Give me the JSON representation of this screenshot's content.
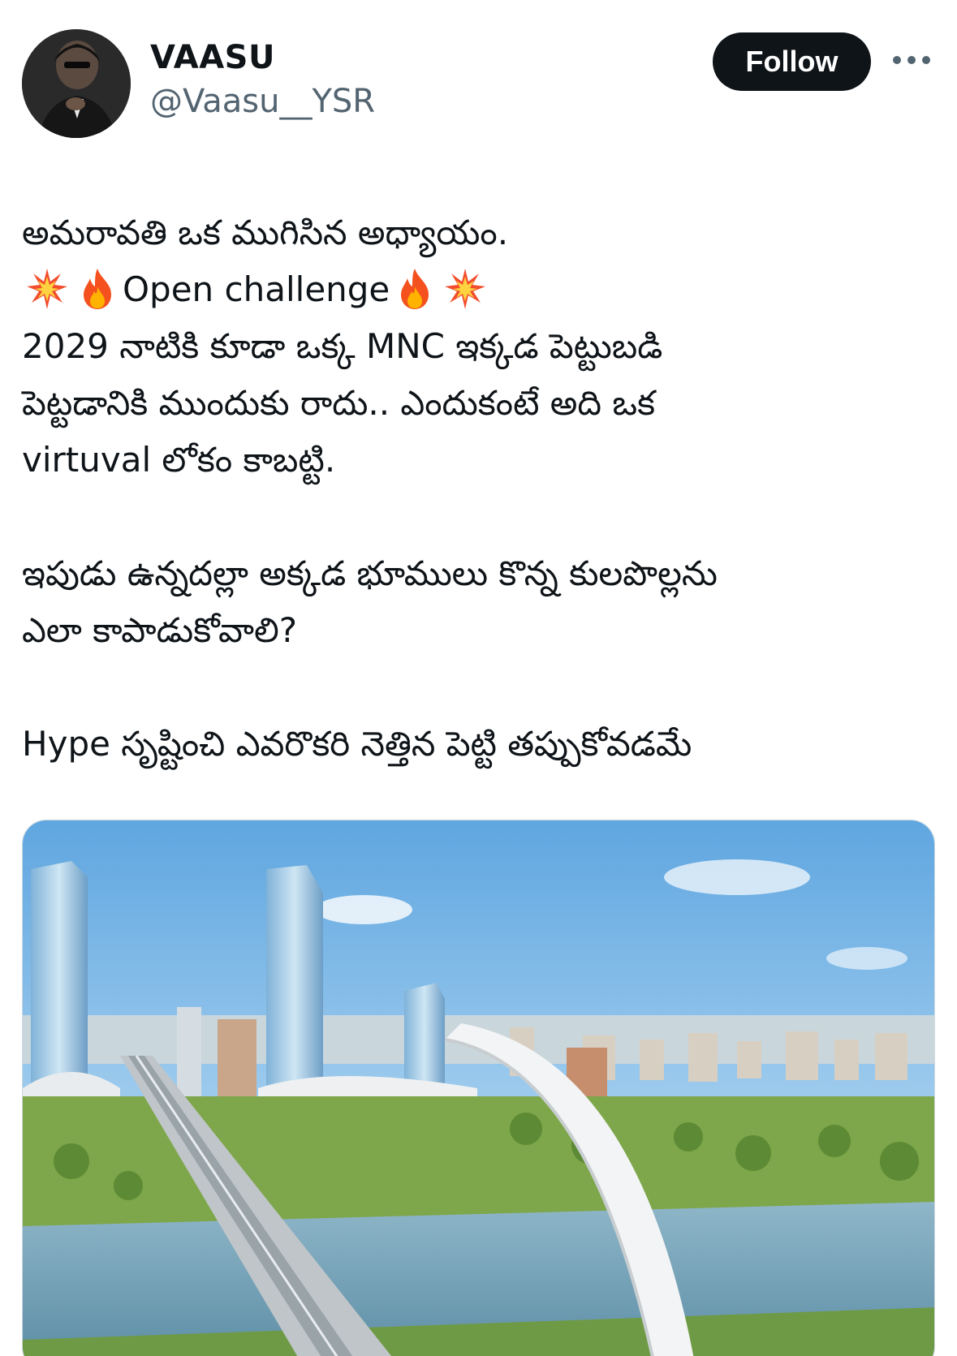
{
  "author": {
    "display_name": "VAASU",
    "handle": "@Vaasu__YSR"
  },
  "follow_label": "Follow",
  "more_icon": "more-horizontal-icon",
  "tweet": {
    "line1": "అమరావతి ఒక ముగిసిన అధ్యాయం.",
    "line2_emojis": [
      "collision-icon",
      "fire-icon"
    ],
    "line2_text": "Open challenge",
    "line3": "2029 నాటికి కూడా ఒక్క MNC ఇక్కడ పెట్టుబడి",
    "line4": "పెట్టడానికి ముందుకు రాదు.. ఎందుకంటే అది ఒక",
    "line5": "virtuval లోకం కాబట్టి.",
    "line6": "ఇపుడు ఉన్నదల్లా అక్కడ భూములు కొన్న కులపొల్లను",
    "line7": "ఎలా కాపాడుకోవాలి?",
    "line8": "Hype సృష్టించి ఎవరొకరి నెత్తిన పెట్టి తప్పుకోవడమే"
  },
  "media": {
    "kind": "image",
    "alt": "Aerial rendering of a planned city with skyscrapers, elevated rail line and arch bridge over a river"
  },
  "colors": {
    "text": "#0f1419",
    "secondary": "#536471",
    "button_bg": "#0f1419",
    "button_fg": "#ffffff"
  }
}
